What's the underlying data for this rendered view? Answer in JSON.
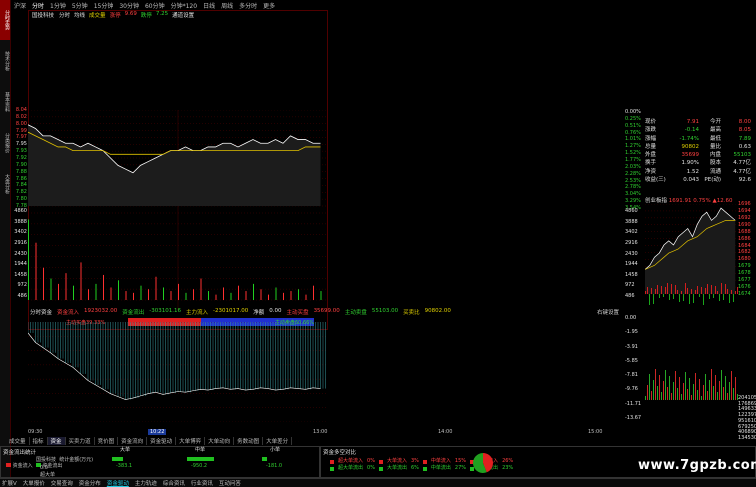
{
  "sidebar": {
    "tabs": [
      "分时走势",
      "技术分析",
      "基本资料",
      "分类报价",
      "大盘分析"
    ],
    "active": 0
  },
  "periodbar": {
    "items": [
      "沪深",
      "分时",
      "1分钟",
      "5分钟",
      "15分钟",
      "30分钟",
      "60分钟",
      "分钟*120",
      "日线",
      "周线",
      "多分时",
      "更多"
    ],
    "selected": 1
  },
  "chart_title": "国投科技",
  "legend1": {
    "items": [
      "分时",
      "均线",
      "成交量",
      "涨停",
      "9.69",
      "跌停",
      "7.25",
      "通道设置"
    ]
  },
  "price_axis": {
    "left": [
      "8.04",
      "8.02",
      "8.00",
      "7.99",
      "7.97",
      "7.95",
      "7.93",
      "7.92",
      "7.90",
      "7.88",
      "7.86",
      "7.84",
      "7.82",
      "7.80",
      "7.78"
    ],
    "right": [
      "0.00%",
      "0.25%",
      "0.51%",
      "0.76%",
      "1.01%",
      "1.27%",
      "1.52%",
      "1.77%",
      "2.03%",
      "2.28%",
      "2.53%",
      "2.78%",
      "3.04%",
      "3.29%",
      "3.54%"
    ]
  },
  "volume_axis": {
    "left": [
      "4860",
      "3888",
      "3402",
      "2916",
      "2430",
      "1944",
      "1458",
      "972",
      "486"
    ],
    "right": [
      "4860",
      "3888",
      "3402",
      "2916",
      "2430",
      "1944",
      "1458",
      "972",
      "486"
    ]
  },
  "fund_legend": {
    "items": [
      "分时资金",
      "资金流入",
      "1923032.00",
      "资金流出",
      "-303101.16",
      "主力流入",
      "-2301017.00",
      "净额",
      "0.00",
      "主动买盘",
      "35699.00",
      "主动卖盘",
      "55103.00",
      "买卖比",
      "90802.00"
    ],
    "right_label": "右键设置"
  },
  "fund_bar": {
    "buy_label": "主动买盘39.33%",
    "sell_label": "主动卖盘60.66%",
    "buy_ratio": 0.3933
  },
  "fund_axis": [
    "0.00",
    "-1.95",
    "-3.91",
    "-5.85",
    "-7.81",
    "-9.76",
    "-11.71",
    "-13.67"
  ],
  "time_axis": {
    "labels": [
      "09:30",
      "10:22",
      "13:00",
      "14:00",
      "15:00"
    ],
    "cursor": "10:22"
  },
  "intraday_chart": {
    "type": "line",
    "x_labels": [
      "09:30",
      "13:00",
      "15:00"
    ],
    "price_range": [
      7.78,
      8.04
    ],
    "price": [
      8.0,
      7.99,
      7.97,
      7.97,
      7.96,
      7.95,
      7.95,
      7.94,
      7.95,
      7.94,
      7.93,
      7.91,
      7.89,
      7.88,
      7.87,
      7.89,
      7.9,
      7.91,
      7.92,
      7.93,
      7.93,
      7.94,
      7.93,
      7.93,
      7.94,
      7.94,
      7.95,
      7.95,
      7.94,
      7.95,
      7.96,
      7.95,
      7.95,
      7.96,
      7.95,
      7.97,
      7.96,
      7.96,
      7.95,
      7.95
    ],
    "avg": [
      7.98,
      7.97,
      7.96,
      7.95,
      7.94,
      7.94,
      7.93,
      7.93,
      7.93,
      7.93,
      7.93,
      7.92,
      7.92,
      7.92,
      7.92,
      7.92,
      7.92,
      7.92,
      7.92,
      7.93,
      7.93,
      7.93,
      7.93,
      7.93,
      7.93,
      7.93,
      7.93,
      7.93,
      7.93,
      7.93,
      7.93,
      7.93,
      7.93,
      7.93,
      7.93,
      7.93,
      7.93,
      7.94,
      7.94,
      7.94
    ],
    "volume": [
      4500,
      3200,
      1800,
      1200,
      900,
      1500,
      800,
      2100,
      600,
      900,
      1400,
      700,
      1100,
      500,
      400,
      800,
      600,
      1300,
      700,
      500,
      900,
      400,
      600,
      1200,
      500,
      300,
      700,
      400,
      800,
      500,
      900,
      600,
      300,
      700,
      400,
      500,
      600,
      300,
      800,
      500
    ]
  },
  "fund_chart": {
    "type": "area",
    "values": [
      -1.5,
      -2.8,
      -3.5,
      -4.2,
      -5.0,
      -5.6,
      -6.2,
      -7.1,
      -8.0,
      -8.6,
      -9.2,
      -9.8,
      -10.2,
      -10.6,
      -10.4,
      -10.1,
      -9.8,
      -9.6,
      -9.9,
      -9.7,
      -9.5,
      -9.6,
      -9.4,
      -9.2,
      -9.3,
      -9.1,
      -9.0,
      -9.2,
      -9.1,
      -9.3,
      -9.2,
      -9.0,
      -9.1,
      -9.3,
      -9.2,
      -9.0,
      -9.1,
      -9.2,
      -9.0,
      -9.1
    ],
    "range": [
      -13.67,
      0
    ]
  },
  "quote": {
    "rows": [
      {
        "l1": "现价",
        "v1": "7.91",
        "c1": "red",
        "l2": "今开",
        "v2": "8.00",
        "c2": "red"
      },
      {
        "l1": "涨跌",
        "v1": "-0.14",
        "c1": "green",
        "l2": "最高",
        "v2": "8.05",
        "c2": "red"
      },
      {
        "l1": "涨幅",
        "v1": "-1.74%",
        "c1": "green",
        "l2": "最低",
        "v2": "7.89",
        "c2": "green"
      },
      {
        "l1": "总量",
        "v1": "90802",
        "c1": "yellow",
        "l2": "量比",
        "v2": "0.63",
        "c2": "white"
      },
      {
        "l1": "外盘",
        "v1": "35699",
        "c1": "red",
        "l2": "内盘",
        "v2": "55103",
        "c2": "green"
      },
      {
        "l1": "换手",
        "v1": "1.90%",
        "c1": "white",
        "l2": "股本",
        "v2": "4.77亿",
        "c2": "white"
      },
      {
        "l1": "净资",
        "v1": "1.52",
        "c1": "white",
        "l2": "流通",
        "v2": "4.77亿",
        "c2": "white"
      },
      {
        "l1": "收益(三)",
        "v1": "0.043",
        "c1": "white",
        "l2": "PE(动)",
        "v2": "92.6",
        "c2": "white"
      }
    ]
  },
  "index_panel": {
    "title": "创业板指",
    "value": "1691.91",
    "change": "0.75%",
    "delta": "12.60",
    "right_axis": [
      "1696",
      "1694",
      "1692",
      "1690",
      "1688",
      "1686",
      "1684",
      "1682",
      "1680",
      "1679",
      "1678",
      "1677",
      "1676",
      "1674"
    ],
    "volume_axis": [
      "2041050",
      "1768690",
      "1496330",
      "1223970",
      "951610",
      "679250",
      "406890",
      "134530"
    ],
    "chart_data": {
      "type": "line",
      "price_range": [
        1674,
        1696
      ],
      "price": [
        1680,
        1681,
        1683,
        1684,
        1686,
        1687,
        1686,
        1688,
        1689,
        1690,
        1688,
        1691,
        1693,
        1694,
        1692,
        1693,
        1695,
        1694,
        1693,
        1692
      ],
      "avg": [
        1680,
        1680.5,
        1681,
        1682,
        1683,
        1684,
        1684.5,
        1685,
        1686,
        1687,
        1687.5,
        1688,
        1689,
        1690,
        1690.5,
        1691,
        1691.5,
        1692,
        1692,
        1692
      ]
    }
  },
  "bottom_tabs": {
    "items": [
      "成交量",
      "指标",
      "资金",
      "买卖力道",
      "竞价图",
      "资金流向",
      "资金驱动",
      "大单博弈",
      "大单动向",
      "务数动图",
      "大单差分"
    ],
    "selected": 2
  },
  "fund_flow": {
    "title": "资金流出统计",
    "sub": [
      "国投科技",
      "统计金额(万元)"
    ],
    "legend": [
      "资金流入",
      "资金流出"
    ],
    "columns": [
      {
        "name": "大单",
        "value": "-383.1"
      },
      {
        "name": "中单",
        "value": "-950.2"
      },
      {
        "name": "小单",
        "value": "-181.0"
      }
    ],
    "zero_label": "0.0",
    "y_label": "超大单"
  },
  "fund_compare": {
    "title": "资金多空对比",
    "rows": [
      {
        "a": "超大单流入",
        "ap": "0%",
        "b": "大单流入",
        "bp": "3%",
        "c": "中单流入",
        "cp": "15%",
        "d": "小单流入",
        "dp": "26%"
      },
      {
        "a": "超大单流出",
        "ap": "0%",
        "b": "大单流出",
        "bp": "6%",
        "c": "中单流出",
        "cp": "27%",
        "d": "小单流出",
        "dp": "23%"
      }
    ]
  },
  "status_bar": {
    "items": [
      "扩展V",
      "大单报价",
      "交易查询",
      "资金分布",
      "资金驱动",
      "主力轨迹",
      "综合资讯",
      "行业资讯",
      "互动问答"
    ],
    "selected": 4
  },
  "watermark": "www.7gpzb.com",
  "colors": {
    "up": "#ff3030",
    "down": "#20d020",
    "price_line": "#ffffff",
    "avg_line": "#e0c000",
    "grid": "#5a0000",
    "buy_bar": "#e02020",
    "sell_bar": "#2030d0"
  }
}
